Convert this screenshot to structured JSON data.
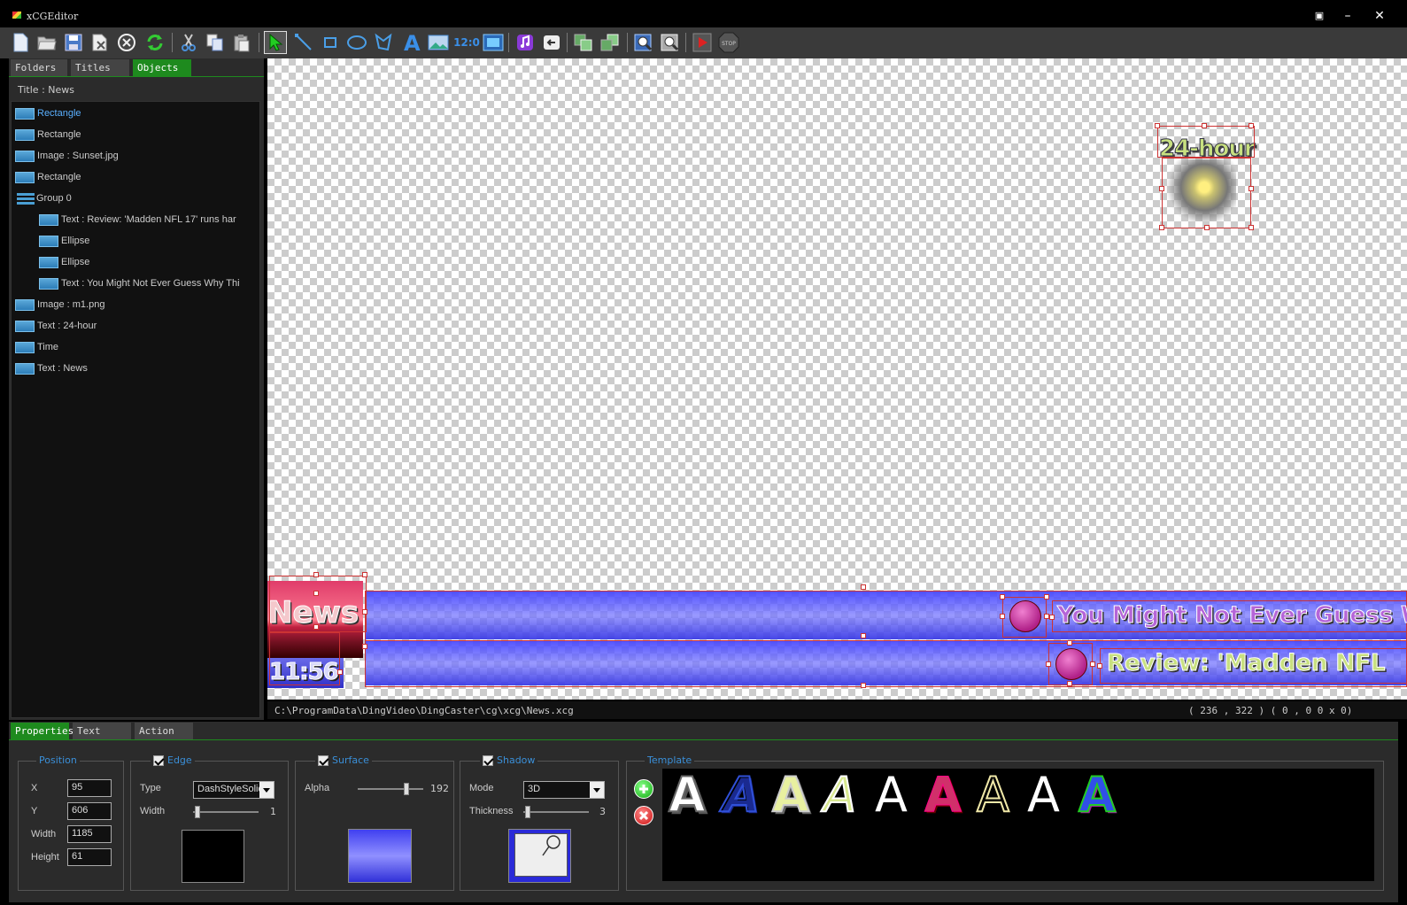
{
  "window": {
    "title": "xCGEditor"
  },
  "toolbar": {
    "time_label": "12:0"
  },
  "left_tabs": [
    {
      "label": "Folders"
    },
    {
      "label": "Titles"
    },
    {
      "label": "Objects"
    }
  ],
  "tree": {
    "title": "Title : News",
    "items": [
      {
        "label": "Rectangle"
      },
      {
        "label": "Rectangle"
      },
      {
        "label": "Image : Sunset.jpg"
      },
      {
        "label": "Rectangle"
      },
      {
        "label": "Group 0"
      },
      {
        "label": "Text : Review: 'Madden NFL 17' runs har"
      },
      {
        "label": "Ellipse"
      },
      {
        "label": "Ellipse"
      },
      {
        "label": "Text : You Might Not Ever Guess Why Thi"
      },
      {
        "label": "Image : m1.png"
      },
      {
        "label": "Text : 24-hour"
      },
      {
        "label": "Time"
      },
      {
        "label": "Text : News"
      }
    ]
  },
  "canvas": {
    "hour_text": "24-hour",
    "news_text": "News",
    "time_text": "11:56",
    "ticker1": "You Might Not Ever Guess Wh",
    "ticker2": "Review: 'Madden NFL"
  },
  "status": {
    "path": "C:\\ProgramData\\DingVideo\\DingCaster\\cg\\xcg\\News.xcg",
    "coords": "( 236 , 322 )  ( 0 ,  0    0 x  0)"
  },
  "bottom_tabs": [
    {
      "label": "Properties"
    },
    {
      "label": "Text"
    },
    {
      "label": "Action"
    }
  ],
  "position": {
    "title": "Position",
    "x_label": "X",
    "x": "95",
    "y_label": "Y",
    "y": "606",
    "width_label": "Width",
    "width": "1185",
    "height_label": "Height",
    "height": "61"
  },
  "edge": {
    "title": "Edge",
    "type_label": "Type",
    "type": "DashStyleSolid",
    "width_label": "Width",
    "width": "1",
    "width_level": 0.05,
    "color": "#000000"
  },
  "surface": {
    "title": "Surface",
    "alpha_label": "Alpha",
    "alpha": "192",
    "alpha_level": 0.75
  },
  "shadow": {
    "title": "Shadow",
    "mode_label": "Mode",
    "mode": "3D",
    "thickness_label": "Thickness",
    "thickness": "3",
    "thickness_level": 0.05
  },
  "template": {
    "title": "Template",
    "glyphs": [
      "A",
      "A",
      "A",
      "A",
      "A",
      "A",
      "A",
      "A",
      "A"
    ]
  },
  "colors": {
    "accent_green": "#1e8a1e",
    "label_blue": "#3a8fd8",
    "selection_red": "#cc3333"
  }
}
